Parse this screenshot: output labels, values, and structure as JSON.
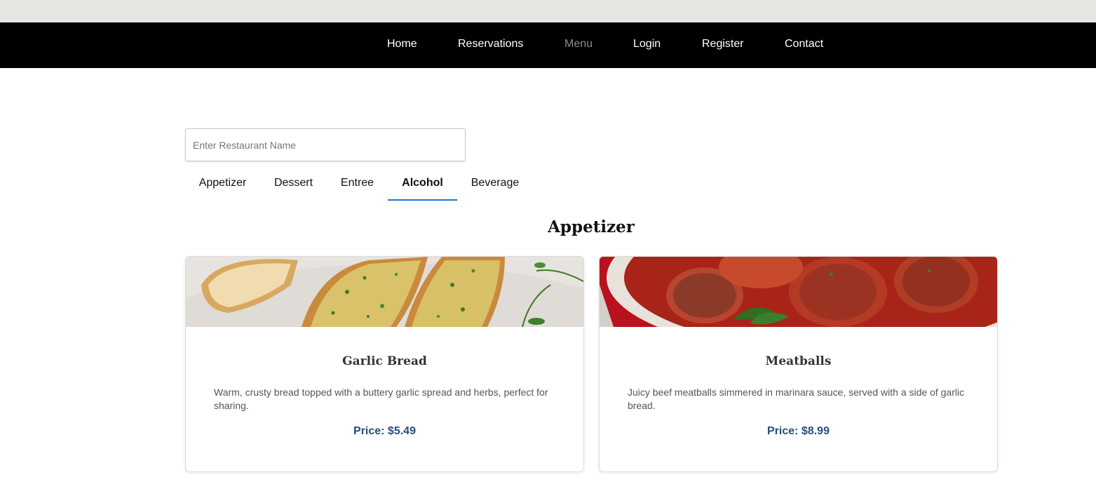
{
  "nav": {
    "items": [
      {
        "label": "Home"
      },
      {
        "label": "Reservations"
      },
      {
        "label": "Menu",
        "active": true
      },
      {
        "label": "Login"
      },
      {
        "label": "Register"
      },
      {
        "label": "Contact"
      }
    ]
  },
  "search": {
    "placeholder": "Enter Restaurant Name",
    "value": ""
  },
  "tabs": {
    "items": [
      {
        "label": "Appetizer"
      },
      {
        "label": "Dessert"
      },
      {
        "label": "Entree"
      },
      {
        "label": "Alcohol",
        "selected": true
      },
      {
        "label": "Beverage"
      }
    ]
  },
  "section": {
    "title": "Appetizer"
  },
  "items": [
    {
      "name": "Garlic Bread",
      "description": "Warm, crusty bread topped with a buttery garlic spread and herbs, perfect for sharing.",
      "price": "Price: $5.49"
    },
    {
      "name": "Meatballs",
      "description": "Juicy beef meatballs simmered in marinara sauce, served with a side of garlic bread.",
      "price": "Price: $8.99"
    }
  ],
  "colors": {
    "navbar": "#000000",
    "active_nav": "#8a8a8a",
    "tab_underline": "#1e74d2",
    "price": "#2b4d7a"
  }
}
